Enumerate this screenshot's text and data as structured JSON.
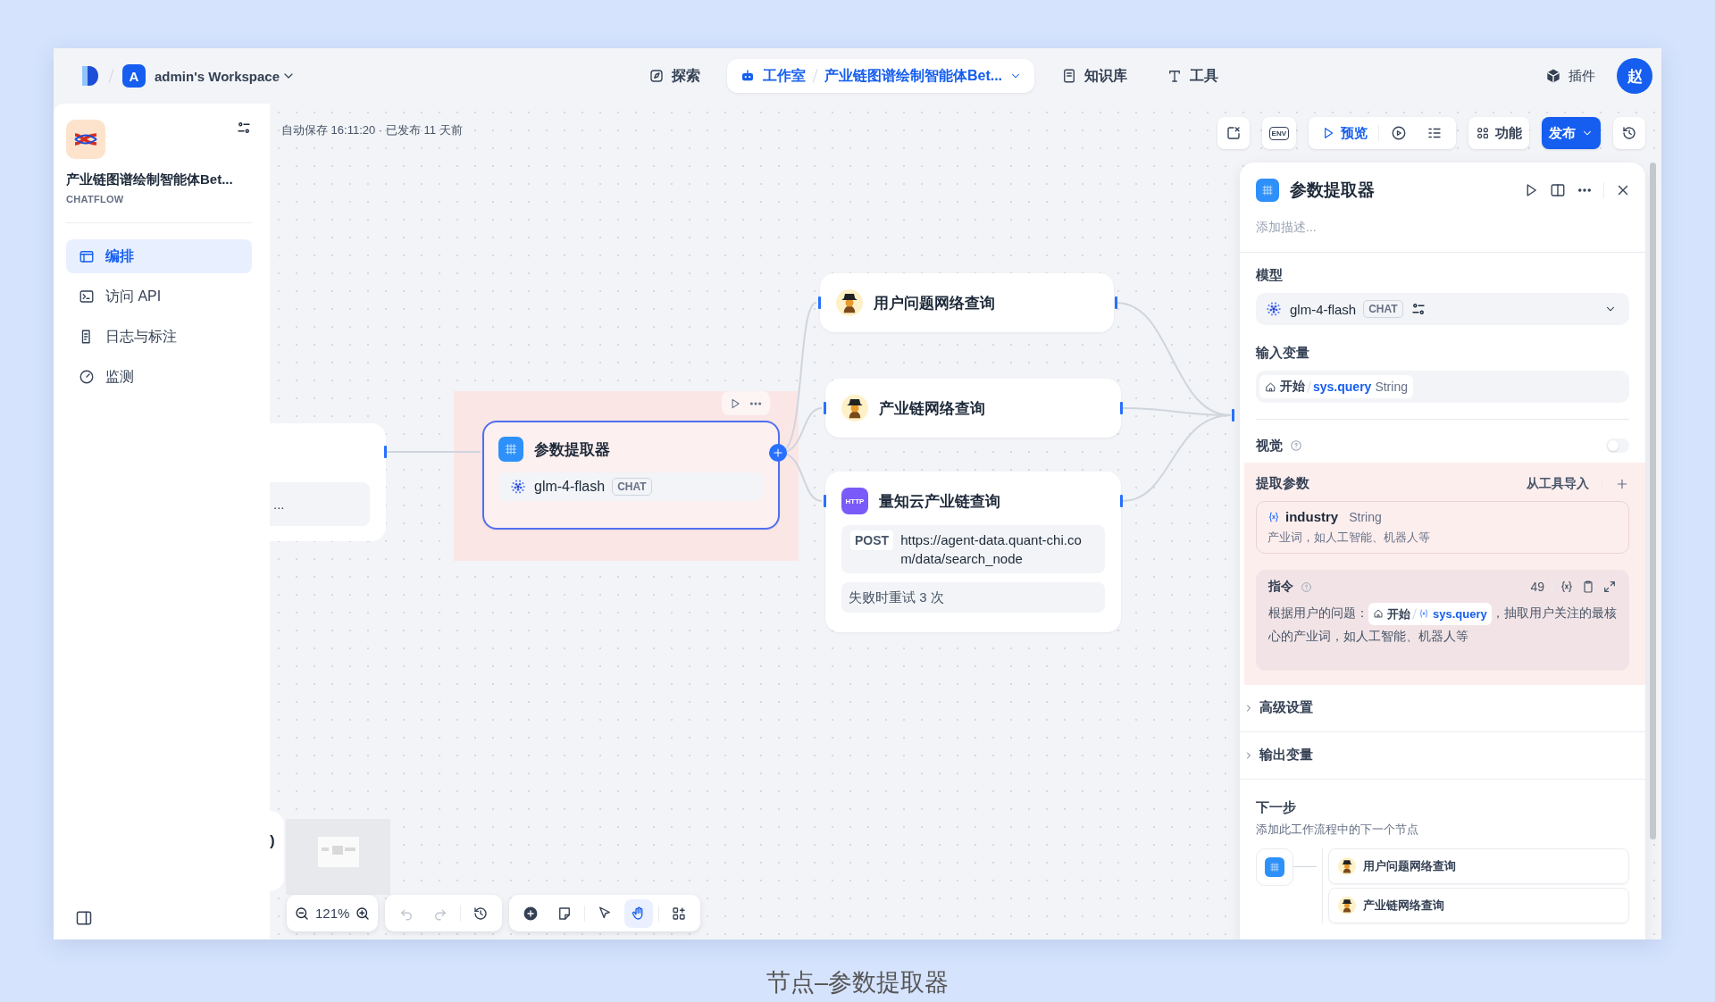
{
  "topbar": {
    "workspace_initial": "A",
    "workspace": "admin's Workspace",
    "nav": [
      {
        "kind": "explore",
        "label": "探索",
        "selected": false
      },
      {
        "kind": "studio",
        "label": "工作室",
        "app": "产业链图谱绘制智能体Bet...",
        "selected": true
      },
      {
        "kind": "knowledge",
        "label": "知识库",
        "selected": false
      },
      {
        "kind": "tools",
        "label": "工具",
        "selected": false
      }
    ],
    "plugins": "插件",
    "avatar": "赵"
  },
  "sidebar": {
    "app_name": "产业链图谱绘制智能体Bet...",
    "app_type": "CHATFLOW",
    "items": [
      {
        "kind": "layout",
        "label": "编排",
        "selected": true
      },
      {
        "kind": "terminal",
        "label": "访问 API",
        "selected": false
      },
      {
        "kind": "log",
        "label": "日志与标注",
        "selected": false
      },
      {
        "kind": "monitor",
        "label": "监测",
        "selected": false
      }
    ]
  },
  "canvas": {
    "status": "自动保存 16:11:20 · 已发布 11 天前",
    "env": "ENV",
    "preview": "预览",
    "features": "功能",
    "publish": "发布",
    "start_node_text": "...",
    "lower_node_text": ")",
    "nodes": [
      {
        "kind": "extractor",
        "title": "参数提取器",
        "model": "glm-4-flash",
        "mode": "CHAT",
        "selected": true
      },
      {
        "kind": "agent",
        "title": "用户问题网络查询",
        "selected": false
      },
      {
        "kind": "agent",
        "title": "产业链网络查询",
        "selected": false
      },
      {
        "kind": "http",
        "badge": "HTTP",
        "title": "量知云产业链查询",
        "method": "POST",
        "url": "https://agent-data.quant-chi.com/data/search_node",
        "retry": "失败时重试 3 次",
        "selected": false
      }
    ],
    "zoom": "121%",
    "history_buttons": [
      {
        "kind": "undo",
        "disabled": true
      },
      {
        "kind": "redo",
        "disabled": true
      },
      {
        "kind": "history",
        "disabled": false
      }
    ],
    "tools": [
      {
        "kind": "add",
        "selected": false
      },
      {
        "kind": "note",
        "selected": false
      },
      {
        "kind": "pointer",
        "selected": false
      },
      {
        "kind": "hand",
        "selected": true
      },
      {
        "kind": "organize",
        "selected": false
      }
    ]
  },
  "panel": {
    "title": "参数提取器",
    "description_placeholder": "添加描述...",
    "model_label": "模型",
    "model": "glm-4-flash",
    "mode": "CHAT",
    "input_label": "输入变量",
    "input": {
      "source": "开始",
      "variable": "sys.query",
      "type": "String"
    },
    "vision_label": "视觉",
    "vision_on": false,
    "params_label": "提取参数",
    "import": "从工具导入",
    "params": [
      {
        "name": "industry",
        "type": "String",
        "description": "产业词，如人工智能、机器人等"
      }
    ],
    "instruction_label": "指令",
    "instruction_count": "49",
    "instruction": {
      "before": "根据用户的问题：",
      "source": "开始",
      "variable": "sys.query",
      "after": "，抽取用户关注的最核心的产业词，如人工智能、机器人等"
    },
    "sections": [
      {
        "label": "高级设置",
        "expanded": false
      },
      {
        "label": "输出变量",
        "expanded": false
      }
    ],
    "next_label": "下一步",
    "next_description": "添加此工作流程中的下一个节点",
    "next_nodes": [
      "用户问题网络查询",
      "产业链网络查询"
    ]
  },
  "caption": "节点–参数提取器"
}
